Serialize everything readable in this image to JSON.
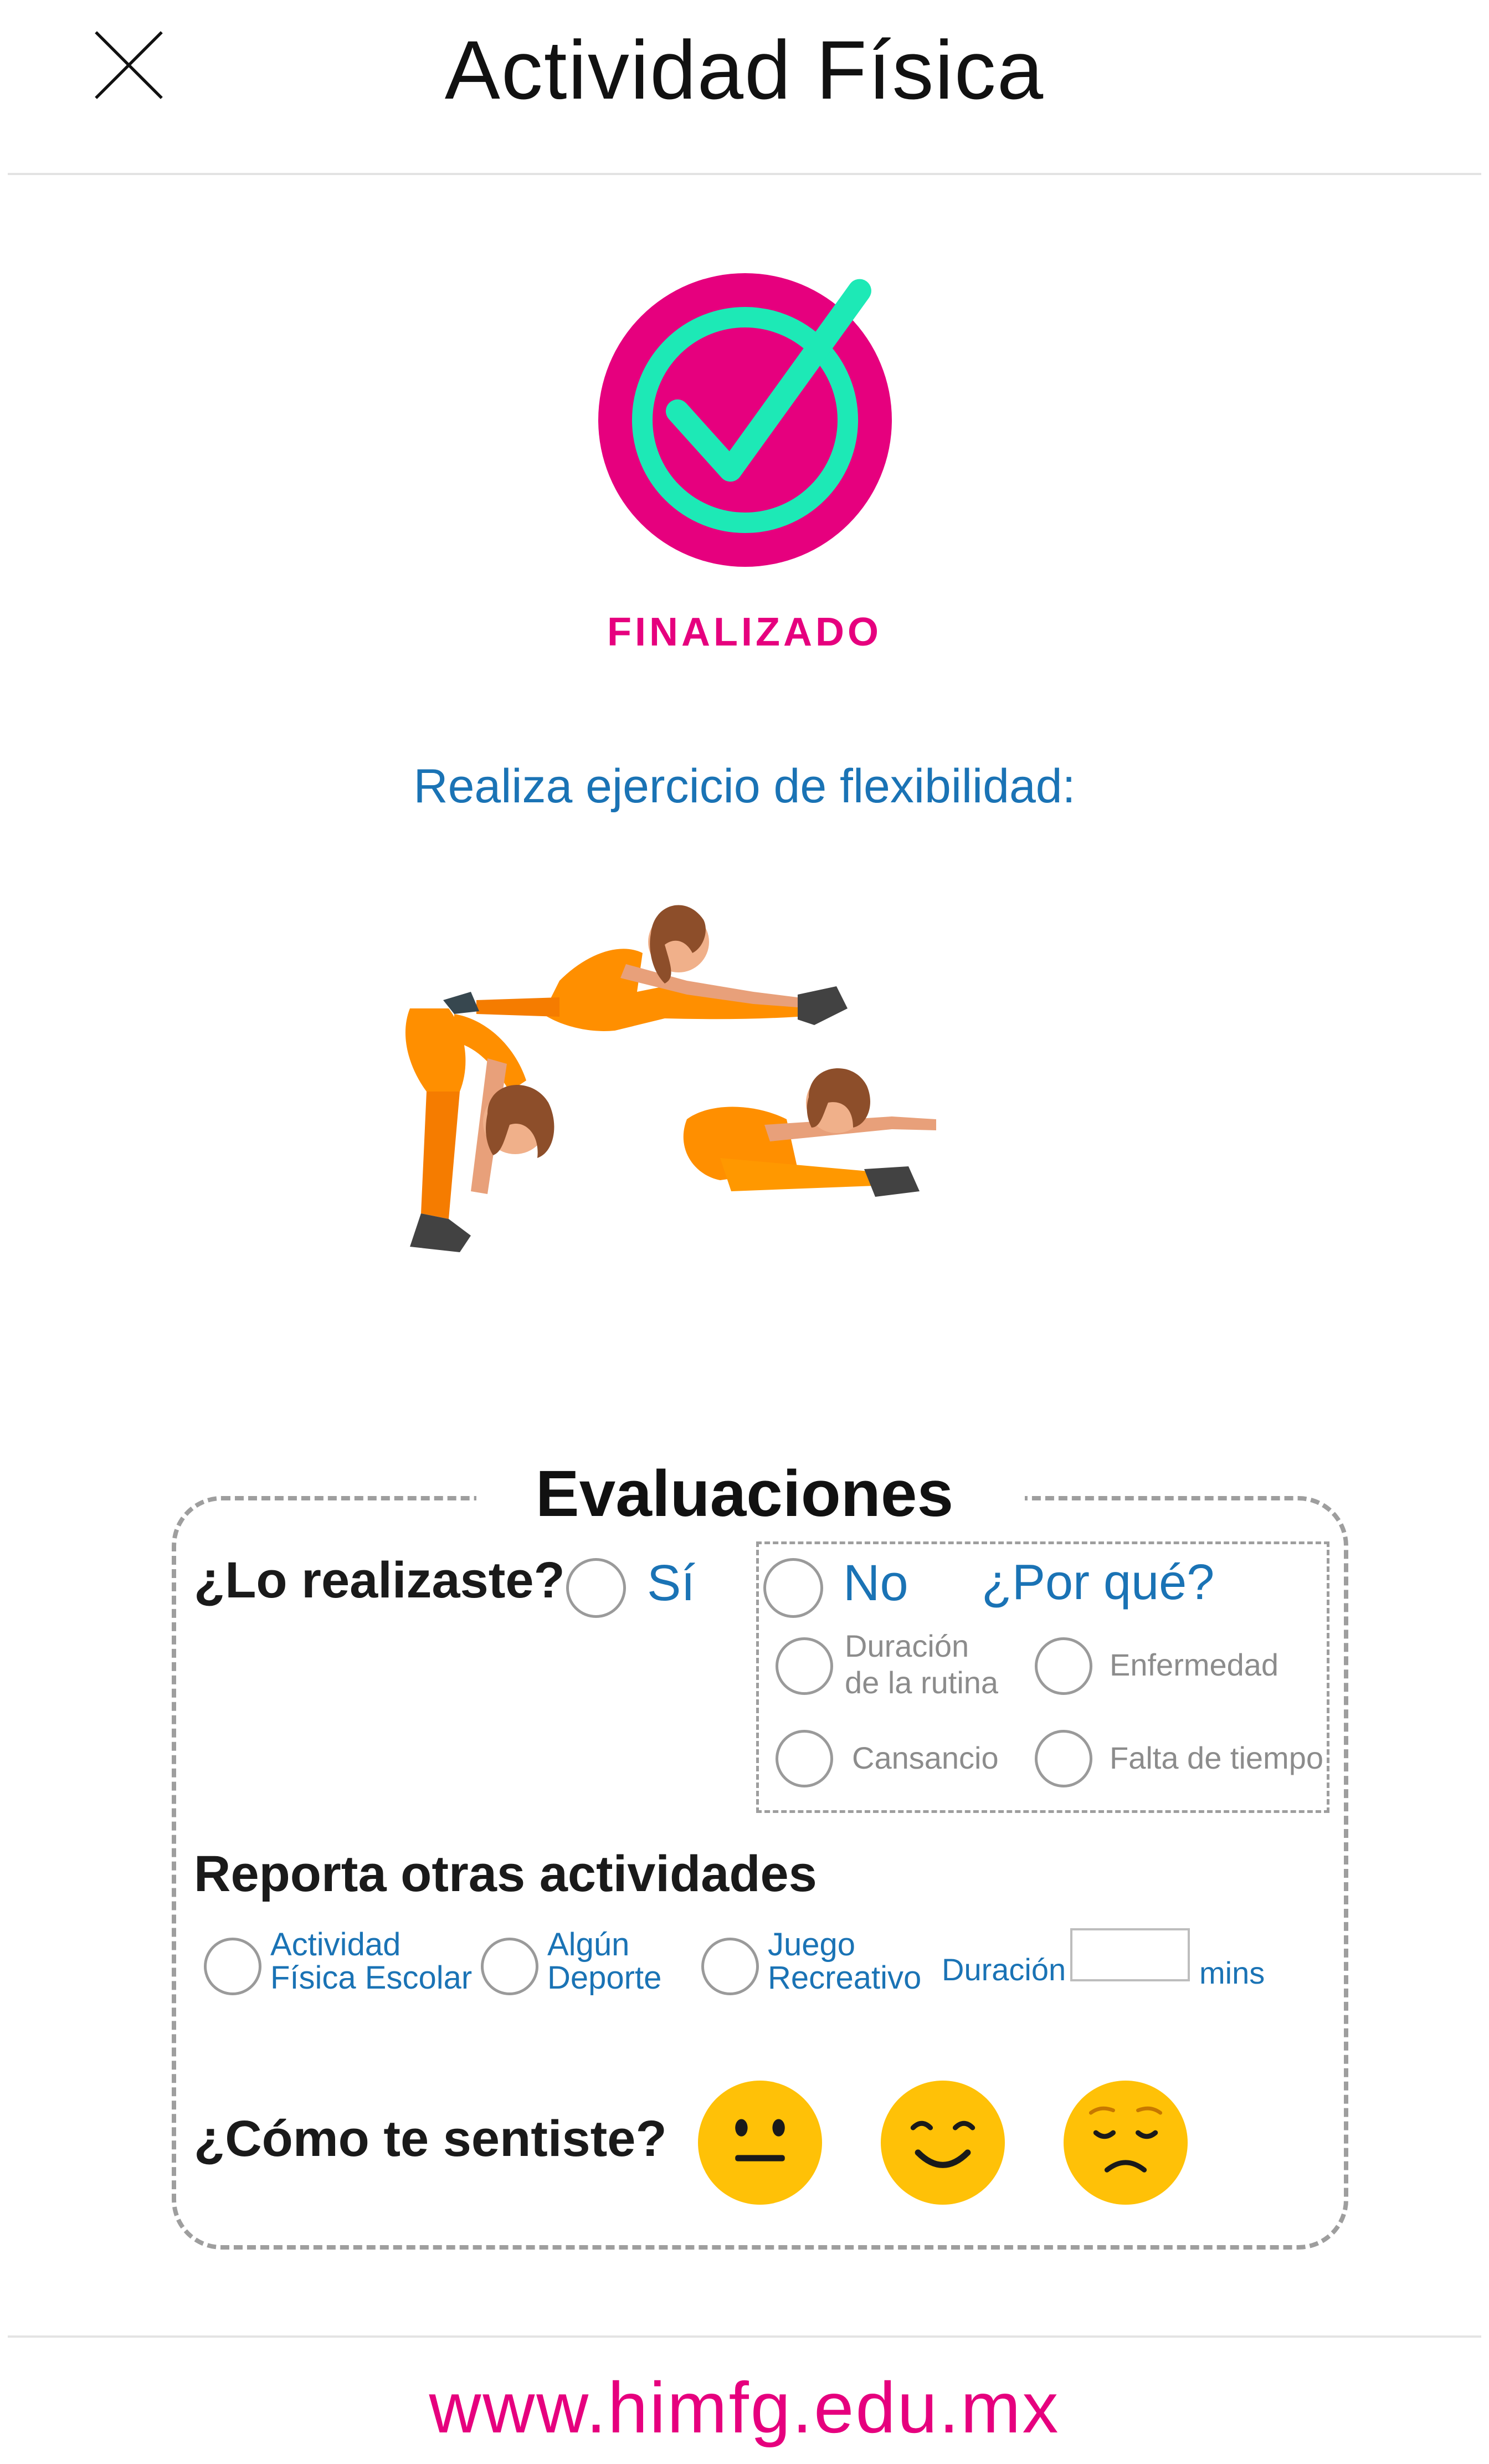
{
  "header": {
    "title": "Actividad Física",
    "close_icon": "close-icon"
  },
  "status": {
    "label": "FINALIZADO",
    "icon": "check-circle-icon",
    "colors": {
      "ring": "#e6007e",
      "check": "#1de9b6"
    }
  },
  "instruction": "Realiza ejercicio de flexibilidad:",
  "illustration": {
    "icon": "stretching-exercises-illustration"
  },
  "evaluation": {
    "title": "Evaluaciones",
    "done_question": "¿Lo realizaste?",
    "yes_label": "Sí",
    "no_label": "No",
    "why_label": "¿Por qué?",
    "reasons": [
      {
        "line1": "Duración",
        "line2": "de la rutina"
      },
      {
        "line1": "Enfermedad",
        "line2": ""
      },
      {
        "line1": "Cansancio",
        "line2": ""
      },
      {
        "line1": "Falta de tiempo",
        "line2": ""
      }
    ],
    "other_title": "Reporta otras actividades",
    "activities": [
      {
        "line1": "Actividad",
        "line2": "Física Escolar"
      },
      {
        "line1": "Algún",
        "line2": "Deporte"
      },
      {
        "line1": "Juego",
        "line2": "Recreativo"
      }
    ],
    "duration_label": "Duración",
    "duration_value": "",
    "duration_unit": "mins",
    "feeling_question": "¿Cómo te sentiste?",
    "feelings": [
      "neutral-face-icon",
      "smiling-face-icon",
      "sad-face-icon"
    ]
  },
  "footer": {
    "url": "www.himfg.edu.mx"
  },
  "colors": {
    "accent_pink": "#e6007e",
    "accent_blue": "#1a73b5",
    "emoji_yellow": "#ffc107"
  }
}
